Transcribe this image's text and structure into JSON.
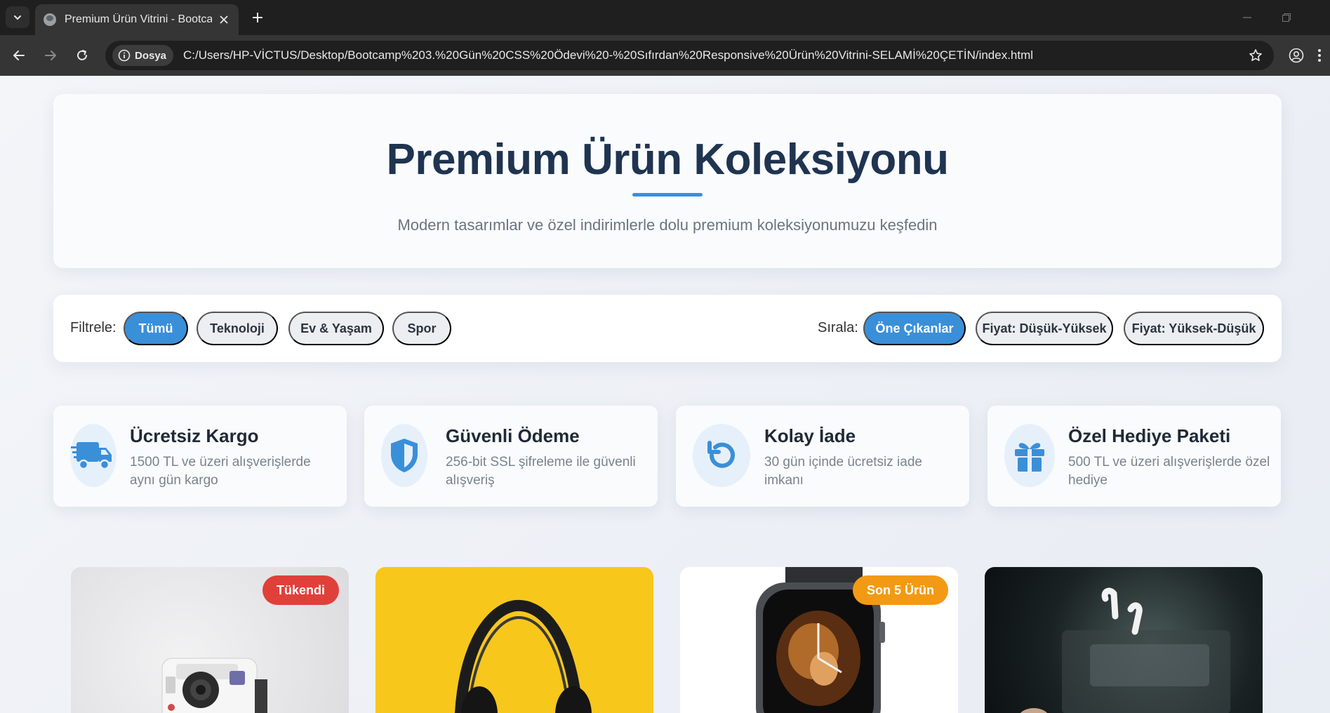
{
  "browser": {
    "tab_title": "Premium Ürün Vitrini - Bootcamp",
    "site_chip": "Dosya",
    "url": "C:/Users/HP-VİCTUS/Desktop/Bootcamp%203.%20Gün%20CSS%20Ödevi%20-%20Sıfırdan%20Responsive%20Ürün%20Vitrini-SELAMİ%20ÇETİN/index.html"
  },
  "hero": {
    "title": "Premium Ürün Koleksiyonu",
    "subtitle": "Modern tasarımlar ve özel indirimlerle dolu premium koleksiyonumuzu keşfedin"
  },
  "filters": {
    "label": "Filtrele:",
    "options": [
      "Tümü",
      "Teknoloji",
      "Ev & Yaşam",
      "Spor"
    ],
    "active": "Tümü"
  },
  "sort": {
    "label": "Sırala:",
    "options": [
      "Öne Çıkanlar",
      "Fiyat: Düşük-Yüksek",
      "Fiyat: Yüksek-Düşük"
    ],
    "active": "Öne Çıkanlar"
  },
  "features": [
    {
      "title": "Ücretsiz Kargo",
      "desc_line1": "1500 TL ve üzeri alışverişlerde",
      "desc_line2": "aynı gün kargo",
      "icon": "truck-icon"
    },
    {
      "title": "Güvenli Ödeme",
      "desc_line1": "256-bit SSL şifreleme ile güvenli",
      "desc_line2": "alışveriş",
      "icon": "shield-icon"
    },
    {
      "title": "Kolay İade",
      "desc_line1": "30 gün içinde ücretsiz iade",
      "desc_line2": "imkanı",
      "icon": "undo-icon"
    },
    {
      "title": "Özel Hediye Paketi",
      "desc_line1": "500 TL ve üzeri alışverişlerde özel",
      "desc_line2": "hediye",
      "icon": "gift-icon"
    }
  ],
  "products": [
    {
      "image": "camera",
      "badge": "Tükendi",
      "badge_color": "#e0403a"
    },
    {
      "image": "headphones",
      "badge": "",
      "badge_color": ""
    },
    {
      "image": "smartwatch",
      "badge": "Son 5 Ürün",
      "badge_color": "#f39a14"
    },
    {
      "image": "earbuds",
      "badge": "",
      "badge_color": ""
    }
  ],
  "colors": {
    "accent": "#3a8fd9",
    "title": "#1f3450",
    "sold_out": "#e0403a",
    "low_stock": "#f39a14"
  }
}
